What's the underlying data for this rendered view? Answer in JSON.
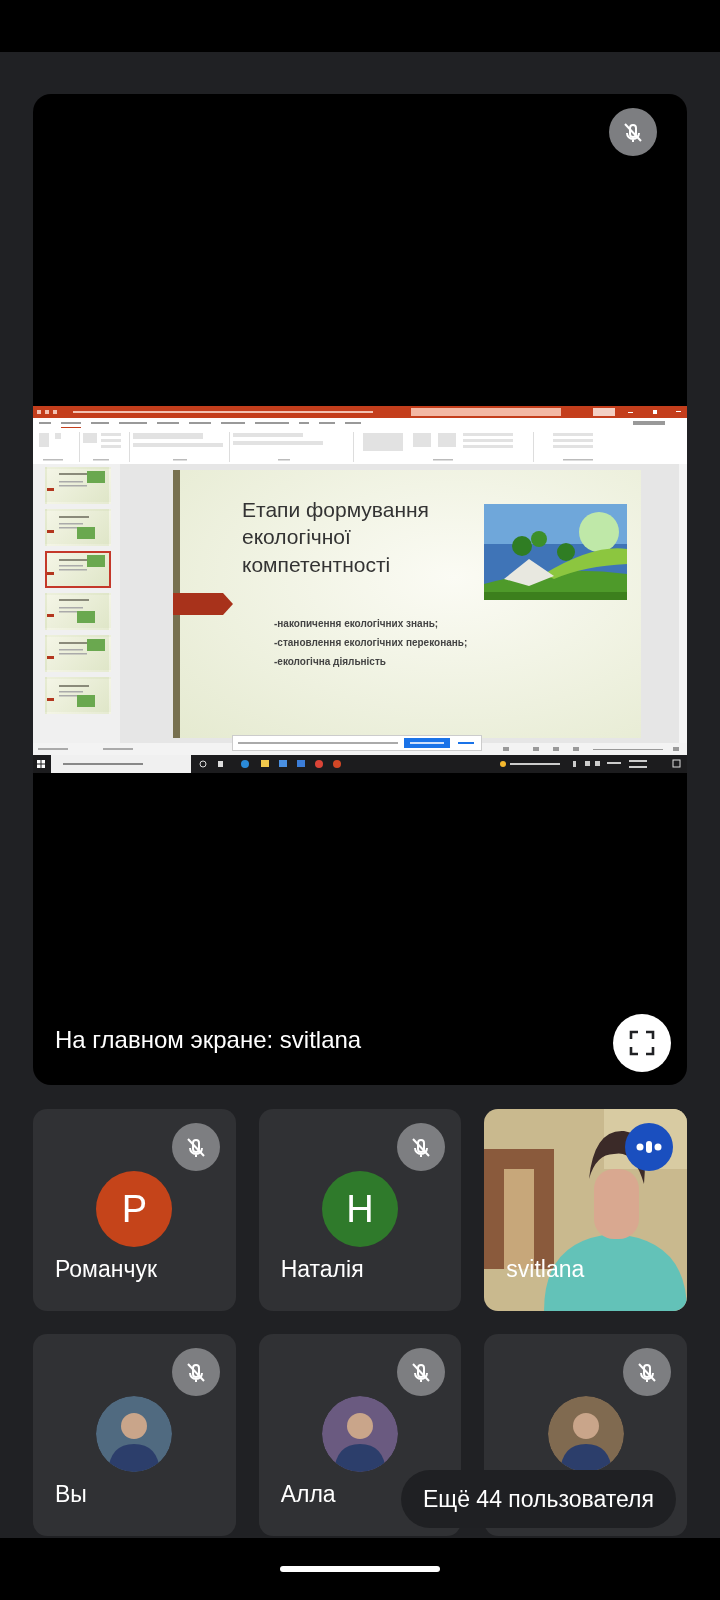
{
  "main_tile": {
    "muted": true,
    "caption": "На главном экране: svitlana",
    "shared_screen": {
      "thumbnails": [
        {
          "selected": false
        },
        {
          "selected": false
        },
        {
          "selected": true
        },
        {
          "selected": false
        },
        {
          "selected": false
        },
        {
          "selected": false
        }
      ],
      "slide": {
        "title": "Етапи формування екологічної компетентності",
        "bullets": [
          "-накопичення екологічних знань;",
          "-становлення екологічних переконань;",
          "-екологічна діяльність"
        ]
      }
    }
  },
  "participants": [
    {
      "name": "Романчук",
      "muted": true,
      "speaking": false,
      "avatar": {
        "kind": "initial",
        "letter": "Р",
        "color": "#c5441a"
      }
    },
    {
      "name": "Наталія",
      "muted": true,
      "speaking": false,
      "avatar": {
        "kind": "initial",
        "letter": "Н",
        "color": "#2f7a2b"
      }
    },
    {
      "name": "svitlana",
      "muted": false,
      "speaking": true,
      "avatar": {
        "kind": "video"
      }
    },
    {
      "name": "Вы",
      "muted": true,
      "speaking": false
    },
    {
      "name": "Алла",
      "muted": true,
      "speaking": false
    },
    {
      "muted": true,
      "speaking": false
    }
  ],
  "more_button": "Ещё 44 пользователя"
}
